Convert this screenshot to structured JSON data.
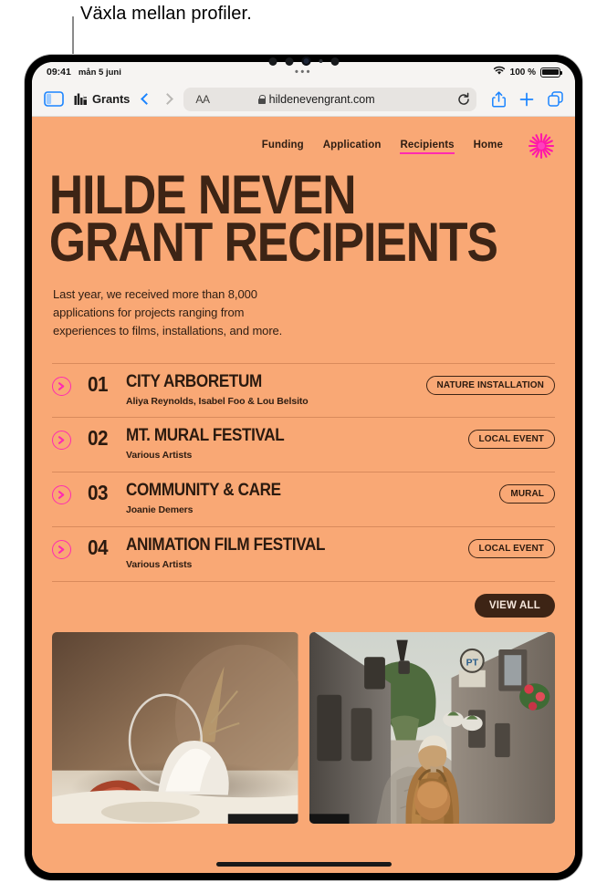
{
  "annotation": {
    "text": "Växla mellan profiler."
  },
  "status_bar": {
    "time": "09:41",
    "date": "mån 5 juni",
    "center_dots": "•••",
    "wifi_icon": "wifi-icon",
    "battery_percent": "100 %",
    "battery_icon": "battery-icon"
  },
  "toolbar": {
    "sidebar_icon": "sidebar-icon",
    "profile_icon": "profile-glyph-icon",
    "profile_label": "Grants",
    "back_icon": "chevron-left-icon",
    "forward_icon": "chevron-right-icon",
    "text_size_label": "AA",
    "lock_icon": "lock-icon",
    "url": "hildenevengrant.com",
    "reload_icon": "reload-icon",
    "share_icon": "share-icon",
    "new_tab_icon": "plus-icon",
    "tabs_icon": "tabs-overview-icon"
  },
  "site": {
    "nav": [
      {
        "label": "Funding",
        "active": false
      },
      {
        "label": "Application",
        "active": false
      },
      {
        "label": "Recipients",
        "active": true
      },
      {
        "label": "Home",
        "active": false
      }
    ],
    "logo_icon": "starburst-logo-icon",
    "hero_title": "HILDE NEVEN\nGRANT RECIPIENTS",
    "hero_subtitle": "Last year, we received more than 8,000\napplications for projects ranging from\nexperiences to films, installations, and more.",
    "recipients": [
      {
        "arrow_icon": "arrow-right-icon",
        "number": "01",
        "title": "CITY ARBORETUM",
        "artists": "Aliya Reynolds, Isabel Foo & Lou Belsito",
        "tag": "NATURE INSTALLATION"
      },
      {
        "arrow_icon": "arrow-right-icon",
        "number": "02",
        "title": "MT. MURAL FESTIVAL",
        "artists": "Various Artists",
        "tag": "LOCAL EVENT"
      },
      {
        "arrow_icon": "arrow-right-icon",
        "number": "03",
        "title": "COMMUNITY & CARE",
        "artists": "Joanie Demers",
        "tag": "MURAL"
      },
      {
        "arrow_icon": "arrow-right-icon",
        "number": "04",
        "title": "ANIMATION FILM FESTIVAL",
        "artists": "Various Artists",
        "tag": "LOCAL EVENT"
      }
    ],
    "view_all_label": "VIEW ALL",
    "cards": [
      {
        "name": "still-life-sculpture-photo"
      },
      {
        "name": "alley-walker-photo"
      }
    ]
  },
  "colors": {
    "page_background": "#f9a875",
    "ink": "#2b1a0f",
    "dark_brown": "#3d2415",
    "accent_pink": "#ff2bb0",
    "toolbar_blue": "#1a84ff",
    "chrome_bg": "#f6f4f2"
  }
}
